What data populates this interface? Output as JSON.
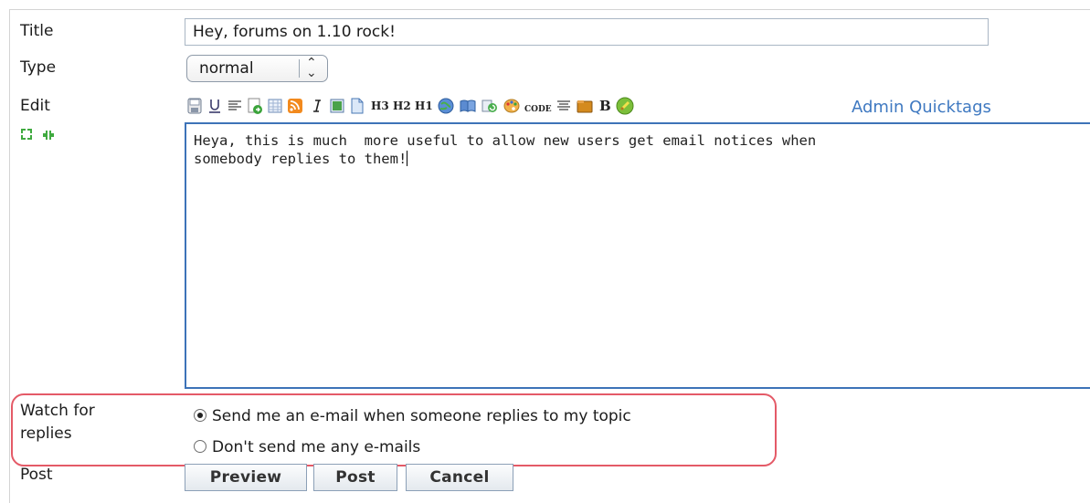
{
  "labels": {
    "title": "Title",
    "type": "Type",
    "edit": "Edit",
    "watch_line1": "Watch for",
    "watch_line2": "replies",
    "post": "Post"
  },
  "title_field": {
    "value": "Hey, forums on 1.10 rock!"
  },
  "type_select": {
    "selected": "normal"
  },
  "toolbar": {
    "text_buttons": {
      "h3": "H3",
      "h2": "H2",
      "h1": "H1",
      "code": "CODE",
      "bold": "B"
    },
    "admin_quicktags": "Admin Quicktags",
    "icons": [
      "save-icon",
      "underline-icon",
      "align-left-icon",
      "page-go-icon",
      "table-icon",
      "rss-icon",
      "italic-icon",
      "image-icon",
      "document-icon",
      "h3-button",
      "h2-button",
      "h1-button",
      "globe-icon",
      "book-icon",
      "refresh-icon",
      "palette-icon",
      "code-button",
      "align-center-icon",
      "folder-icon",
      "bold-button",
      "admin-quicktags-icon"
    ]
  },
  "body_text": "Heya, this is much  more useful to allow new users get email notices when\nsomebody replies to them!",
  "watch": {
    "option_send": "Send me an e-mail when someone replies to my topic",
    "option_none": "Don't send me any e-mails",
    "selected": "send"
  },
  "buttons": {
    "preview": "Preview",
    "post": "Post",
    "cancel": "Cancel"
  },
  "colors": {
    "link": "#3f79c1",
    "focus_border": "#3d73b8",
    "annotation": "#e45a67"
  }
}
